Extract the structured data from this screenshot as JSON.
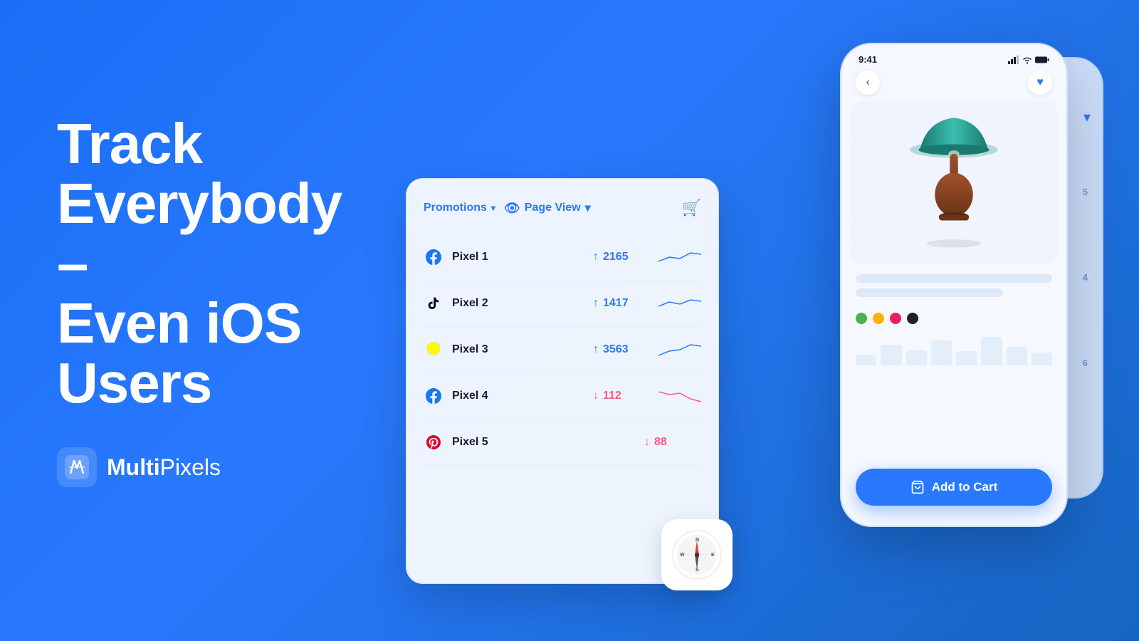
{
  "headline": {
    "line1": "Track",
    "line2": "Everybody –",
    "line3": "Even iOS",
    "line4": "Users"
  },
  "brand": {
    "name_bold": "Multi",
    "name_light": "Pixels"
  },
  "panel": {
    "filter_label": "Promotions",
    "page_view_label": "Page View",
    "pixels": [
      {
        "id": 1,
        "name": "Pixel 1",
        "platform": "facebook",
        "value": "2165",
        "trend": "up"
      },
      {
        "id": 2,
        "name": "Pixel 2",
        "platform": "tiktok",
        "value": "1417",
        "trend": "up"
      },
      {
        "id": 3,
        "name": "Pixel 3",
        "platform": "snapchat",
        "value": "3563",
        "trend": "up"
      },
      {
        "id": 4,
        "name": "Pixel 4",
        "platform": "facebook",
        "value": "112",
        "trend": "down"
      },
      {
        "id": 5,
        "name": "Pixel 5",
        "platform": "pinterest",
        "value": "88",
        "trend": "down"
      }
    ]
  },
  "phone": {
    "time": "9:41",
    "back_label": "‹",
    "add_to_cart_label": "Add to Cart",
    "colors": [
      "#4caf50",
      "#ffb300",
      "#e91e63",
      "#212121"
    ]
  },
  "bg_phone_numbers": [
    "5",
    "4",
    "6"
  ],
  "icons": {
    "cart": "🛒",
    "eye": "👁",
    "heart": "♥",
    "back": "‹",
    "compass": "🧭",
    "shopping_cart_white": "🛒",
    "arrow_up": "↑",
    "arrow_down": "↓"
  }
}
